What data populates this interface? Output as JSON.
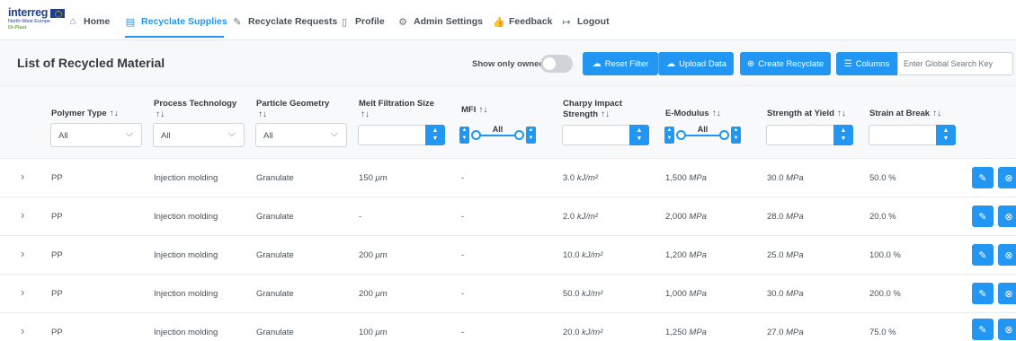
{
  "brand": {
    "logo_word": "interreg",
    "logo_sub": "North-West Europe",
    "logo_project": "Di-Plast"
  },
  "nav": {
    "items": [
      {
        "label": "Home",
        "icon": "home-icon",
        "glyph": "⌂",
        "active": false
      },
      {
        "label": "Recyclate Supplies",
        "icon": "calendar-icon",
        "glyph": "▤",
        "active": true
      },
      {
        "label": "Recyclate Requests",
        "icon": "pencil-icon",
        "glyph": "✎",
        "active": false
      },
      {
        "label": "Profile",
        "icon": "file-icon",
        "glyph": "▯",
        "active": false
      },
      {
        "label": "Admin Settings",
        "icon": "gear-icon",
        "glyph": "⚙",
        "active": false
      },
      {
        "label": "Feedback",
        "icon": "thumbs-up-icon",
        "glyph": "👍",
        "active": false
      },
      {
        "label": "Logout",
        "icon": "logout-icon",
        "glyph": "↦",
        "active": false
      }
    ]
  },
  "page": {
    "title": "List of Recycled Material"
  },
  "toolbar": {
    "show_owned_label": "Show only owned",
    "show_owned": false,
    "reset_filter": "Reset Filter",
    "upload_data": "Upload Data",
    "create_recyclate": "Create Recyclate",
    "columns": "Columns",
    "search_placeholder": "Enter Global Search Key"
  },
  "table": {
    "columns": [
      {
        "line1": "Polymer Type",
        "line2": ""
      },
      {
        "line1": "Process Technology",
        "line2": ""
      },
      {
        "line1": "Particle Geometry",
        "line2": ""
      },
      {
        "line1": "Melt Filtration Size",
        "line2": ""
      },
      {
        "line1": "MFI",
        "line2": ""
      },
      {
        "line1": "Charpy Impact",
        "line2": "Strength"
      },
      {
        "line1": "E-Modulus",
        "line2": ""
      },
      {
        "line1": "Strength at Yield",
        "line2": ""
      },
      {
        "line1": "Strain at Break",
        "line2": ""
      }
    ],
    "sort_glyph": "↑↓",
    "filters": {
      "polymer_type": "All",
      "process_technology": "All",
      "particle_geometry": "All",
      "mfi_range": "All",
      "e_modulus_range": "All"
    },
    "rows": [
      {
        "polymer": "PP",
        "process": "Injection molding",
        "geometry": "Granulate",
        "melt_value": "150",
        "melt_unit": "μm",
        "mfi": "-",
        "charpy_value": "3.0",
        "charpy_unit": "kJ/m²",
        "emod_value": "1,500",
        "emod_unit": "MPa",
        "yield_value": "30.0",
        "yield_unit": "MPa",
        "strain": "50.0 %"
      },
      {
        "polymer": "PP",
        "process": "Injection molding",
        "geometry": "Granulate",
        "melt_value": "-",
        "melt_unit": "",
        "mfi": "-",
        "charpy_value": "2.0",
        "charpy_unit": "kJ/m²",
        "emod_value": "2,000",
        "emod_unit": "MPa",
        "yield_value": "28.0",
        "yield_unit": "MPa",
        "strain": "20.0 %"
      },
      {
        "polymer": "PP",
        "process": "Injection molding",
        "geometry": "Granulate",
        "melt_value": "200",
        "melt_unit": "μm",
        "mfi": "-",
        "charpy_value": "10.0",
        "charpy_unit": "kJ/m²",
        "emod_value": "1,200",
        "emod_unit": "MPa",
        "yield_value": "25.0",
        "yield_unit": "MPa",
        "strain": "100.0 %"
      },
      {
        "polymer": "PP",
        "process": "Injection molding",
        "geometry": "Granulate",
        "melt_value": "200",
        "melt_unit": "μm",
        "mfi": "-",
        "charpy_value": "50.0",
        "charpy_unit": "kJ/m²",
        "emod_value": "1,000",
        "emod_unit": "MPa",
        "yield_value": "30.0",
        "yield_unit": "MPa",
        "strain": "200.0 %"
      },
      {
        "polymer": "PP",
        "process": "Injection molding",
        "geometry": "Granulate",
        "melt_value": "100",
        "melt_unit": "μm",
        "mfi": "-",
        "charpy_value": "20.0",
        "charpy_unit": "kJ/m²",
        "emod_value": "1,250",
        "emod_unit": "MPa",
        "yield_value": "27.0",
        "yield_unit": "MPa",
        "strain": "75.0 %"
      }
    ]
  },
  "colors": {
    "primary": "#2196f3",
    "toggle_off": "#ced4da",
    "text": "#495057",
    "heading": "#343a40"
  }
}
